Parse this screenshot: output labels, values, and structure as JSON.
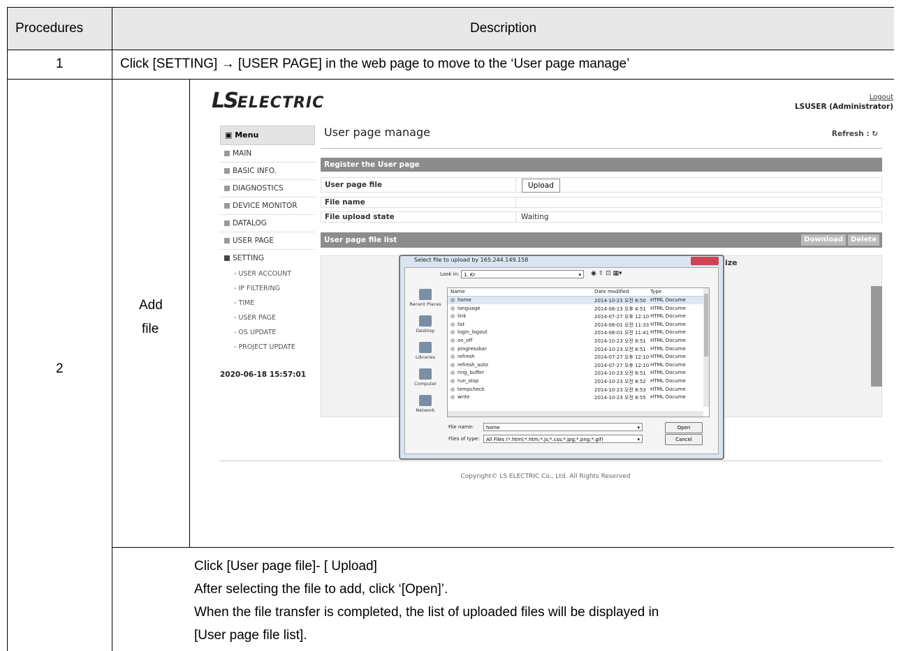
{
  "table": {
    "header_procedures": "Procedures",
    "header_description": "Description",
    "step1_number": "1",
    "step1_text": "Click [SETTING] → [USER PAGE] in the web page to move to the ‘User page manage’",
    "step2_number": "2",
    "step2_label_line1": "Add",
    "step2_label_line2": "file",
    "step2_instructions": [
      "Click [User page file]- [ Upload]",
      "After selecting the file to add, click ‘[Open]’.",
      "When the file transfer is completed, the list of uploaded files will be displayed in",
      "[User page file list]."
    ]
  },
  "screenshot": {
    "logo_ls": "LS",
    "logo_electric": "ELECTRIC",
    "logout": "Logout",
    "user": "LSUSER (Administrator)",
    "menu_title": "Menu",
    "menu_items": [
      "MAIN",
      "BASIC INFO.",
      "DIAGNOSTICS",
      "DEVICE MONITOR",
      "DATALOG",
      "USER PAGE",
      "SETTING"
    ],
    "setting_subitems": [
      "- USER ACCOUNT",
      "- IP FILTERING",
      "- TIME",
      "- USER PAGE",
      "- OS UPDATE",
      "- PROJECT UPDATE"
    ],
    "datetime": "2020-06-18 15:57:01",
    "page_title": "User page manage",
    "refresh": "Refresh : ↻",
    "register_bar": "Register the User page",
    "row_user_page_file": "User page file",
    "upload_button": "Upload",
    "row_file_name": "File name",
    "row_file_upload_state": "File upload state",
    "file_upload_state_value": "Waiting",
    "file_list_bar": "User page file list",
    "download_button": "Download",
    "delete_button": "Delete",
    "size_header": "ize",
    "copyright": "Copyright© LS ELECTRIC Co., Ltd. All Rights Reserved"
  },
  "dialog": {
    "title": "Select file to upload by 165.244.149.158",
    "look_in_label": "Look in:",
    "look_in_value": "1. Kr",
    "places": [
      "Recent Places",
      "Desktop",
      "Libraries",
      "Computer",
      "Network"
    ],
    "col_name": "Name",
    "col_date": "Date modified",
    "col_type": "Type",
    "files": [
      {
        "name": "home",
        "date": "2014-10-23 오전 8:50",
        "type": "HTML Docume"
      },
      {
        "name": "language",
        "date": "2014-08-13 오후 4:51",
        "type": "HTML Docume"
      },
      {
        "name": "link",
        "date": "2014-07-27 오후 12:10",
        "type": "HTML Docume"
      },
      {
        "name": "list",
        "date": "2014-08-01 오전 11:33",
        "type": "HTML Docume"
      },
      {
        "name": "login_logout",
        "date": "2014-08-01 오전 11:41",
        "type": "HTML Docume"
      },
      {
        "name": "on_off",
        "date": "2014-10-23 오전 8:51",
        "type": "HTML Docume"
      },
      {
        "name": "progressbar",
        "date": "2014-10-23 오전 8:51",
        "type": "HTML Docume"
      },
      {
        "name": "refresh",
        "date": "2014-07-27 오후 12:10",
        "type": "HTML Docume"
      },
      {
        "name": "refresh_auto",
        "date": "2014-07-27 오후 12:10",
        "type": "HTML Docume"
      },
      {
        "name": "ring_buffer",
        "date": "2014-10-23 오전 8:51",
        "type": "HTML Docume"
      },
      {
        "name": "run_stop",
        "date": "2014-10-23 오전 8:52",
        "type": "HTML Docume"
      },
      {
        "name": "tempcheck",
        "date": "2014-10-23 오전 8:53",
        "type": "HTML Docume"
      },
      {
        "name": "write",
        "date": "2014-10-23 오전 8:55",
        "type": "HTML Docume"
      }
    ],
    "file_name_label": "File name:",
    "file_name_value": "home",
    "files_of_type_label": "Files of type:",
    "files_of_type_value": "All Files (*.html;*.htm;*.js;*.css;*.jpg;*.png;*.gif)",
    "open_button": "Open",
    "cancel_button": "Cancel"
  }
}
